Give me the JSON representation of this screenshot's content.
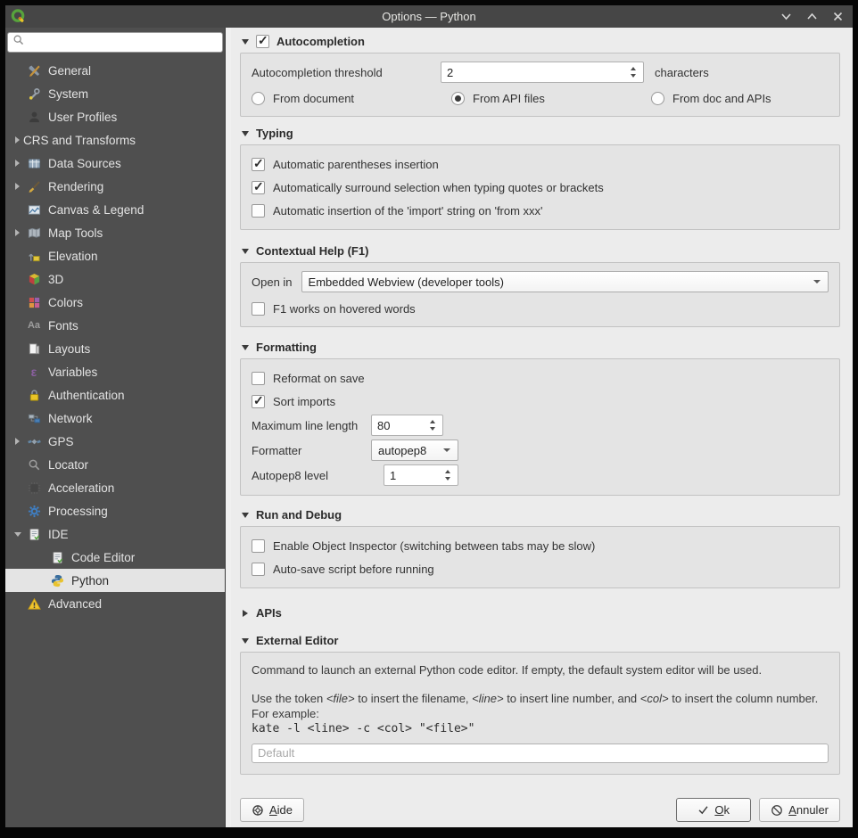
{
  "window": {
    "title": "Options — Python"
  },
  "sidebar": {
    "items": [
      {
        "label": "General",
        "selected": false
      },
      {
        "label": "System",
        "selected": false
      },
      {
        "label": "User Profiles",
        "selected": false
      },
      {
        "label": "CRS and Transforms",
        "selected": false
      },
      {
        "label": "Data Sources",
        "selected": false
      },
      {
        "label": "Rendering",
        "selected": false
      },
      {
        "label": "Canvas & Legend",
        "selected": false
      },
      {
        "label": "Map Tools",
        "selected": false
      },
      {
        "label": "Elevation",
        "selected": false
      },
      {
        "label": "3D",
        "selected": false
      },
      {
        "label": "Colors",
        "selected": false
      },
      {
        "label": "Fonts",
        "selected": false
      },
      {
        "label": "Layouts",
        "selected": false
      },
      {
        "label": "Variables",
        "selected": false
      },
      {
        "label": "Authentication",
        "selected": false
      },
      {
        "label": "Network",
        "selected": false
      },
      {
        "label": "GPS",
        "selected": false
      },
      {
        "label": "Locator",
        "selected": false
      },
      {
        "label": "Acceleration",
        "selected": false
      },
      {
        "label": "Processing",
        "selected": false
      },
      {
        "label": "IDE",
        "selected": false
      },
      {
        "label": "Code Editor",
        "selected": false
      },
      {
        "label": "Python",
        "selected": true
      },
      {
        "label": "Advanced",
        "selected": false
      }
    ],
    "glyphs": {
      "fonts": "Aa",
      "variables": "ε"
    }
  },
  "panel": {
    "autocompletion": {
      "title": "Autocompletion",
      "enabled": true,
      "threshold_label": "Autocompletion threshold",
      "threshold_value": "2",
      "threshold_suffix": "characters",
      "radios": [
        {
          "label": "From document",
          "selected": false
        },
        {
          "label": "From API files",
          "selected": true
        },
        {
          "label": "From doc and APIs",
          "selected": false
        }
      ]
    },
    "typing": {
      "title": "Typing",
      "checkboxes": [
        {
          "label": "Automatic parentheses insertion",
          "checked": true
        },
        {
          "label": "Automatically surround selection when typing quotes or brackets",
          "checked": true
        },
        {
          "label": "Automatic insertion of the 'import' string on 'from xxx'",
          "checked": false
        }
      ]
    },
    "contextual_help": {
      "title": "Contextual Help (F1)",
      "open_in_label": "Open in",
      "open_in_value": "Embedded Webview (developer tools)",
      "checkbox": {
        "label": "F1 works on hovered words",
        "checked": false
      }
    },
    "formatting": {
      "title": "Formatting",
      "reformat": {
        "label": "Reformat on save",
        "checked": false
      },
      "sort_imports": {
        "label": "Sort imports",
        "checked": true
      },
      "max_line_label": "Maximum line length",
      "max_line_value": "80",
      "formatter_label": "Formatter",
      "formatter_value": "autopep8",
      "autopep8_label": "Autopep8 level",
      "autopep8_value": "1"
    },
    "run_debug": {
      "title": "Run and Debug",
      "checkboxes": [
        {
          "label": "Enable Object Inspector (switching between tabs may be slow)",
          "checked": false
        },
        {
          "label": "Auto-save script before running",
          "checked": false
        }
      ]
    },
    "apis": {
      "title": "APIs",
      "collapsed": true
    },
    "external_editor": {
      "title": "External Editor",
      "line1": "Command to launch an external Python code editor. If empty, the default system editor will be used.",
      "line2_parts": {
        "p0": "Use the token ",
        "t0": "<file>",
        "p1": " to insert the filename, ",
        "t1": "<line>",
        "p2": " to insert line number, and ",
        "t2": "<col>",
        "p3": " to insert the column number."
      },
      "line3": "For example:",
      "code": "kate -l <line> -c <col> \"<file>\"",
      "input_placeholder": "Default"
    }
  },
  "footer": {
    "help_mn": "A",
    "help_rest": "ide",
    "ok_mn": "O",
    "ok_rest": "k",
    "cancel_mn": "A",
    "cancel_rest": "nnuler"
  }
}
